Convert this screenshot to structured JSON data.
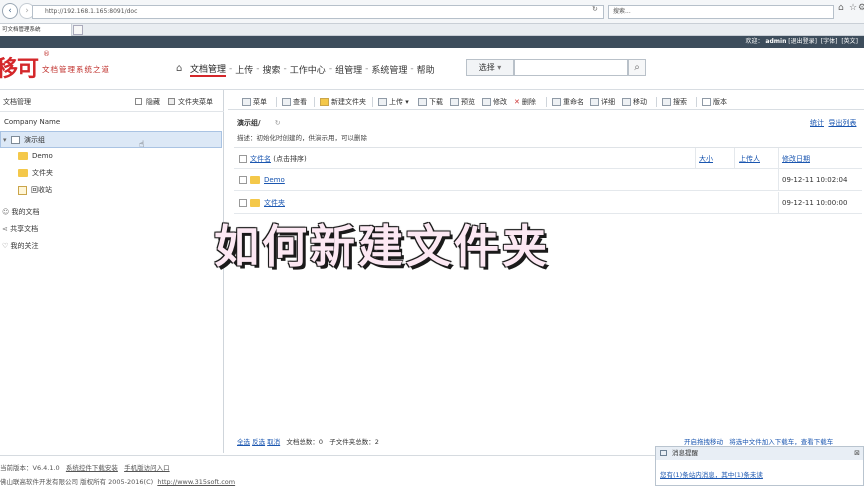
{
  "browser": {
    "address": "http://192.168.1.165:8091/doc",
    "search_placeholder": "搜索...",
    "tab_title": "可文档管理系统"
  },
  "top_strip": {
    "welcome": "欢迎：",
    "user": "admin",
    "logout": "[退出登录]",
    "font": "[字体]",
    "lang": "[英文]"
  },
  "logo": {
    "mark": "移可",
    "tagline": "文档管理系统之道",
    "reg": "®"
  },
  "main_nav": {
    "items": [
      "文档管理",
      "上传",
      "搜索",
      "工作中心",
      "组管理",
      "系统管理",
      "帮助"
    ]
  },
  "search": {
    "select_label": "选择",
    "dropdown_glyph": "▾",
    "button_glyph": "⌕"
  },
  "sidebar": {
    "title": "文档管理",
    "hide": "隐藏",
    "folder_menu": "文件夹菜单",
    "company": "Company Name",
    "group": "演示组",
    "folders": [
      "Demo",
      "文件夹",
      "回收站"
    ],
    "links": [
      "我的文档",
      "共享文档",
      "我的关注"
    ]
  },
  "toolbar": {
    "items": [
      "菜单",
      "查看",
      "新建文件夹",
      "上传",
      "下载",
      "预览",
      "修改",
      "删除",
      "重命名",
      "详细",
      "移动",
      "搜索",
      "版本"
    ]
  },
  "content": {
    "path": "演示组/",
    "desc": "描述：初始化时创建的，供演示用，可以删除",
    "stats_link": "统计",
    "export_link": "导出列表",
    "columns": {
      "name": "文件名",
      "sort_hint": "(点击排序)",
      "size": "大小",
      "uploader": "上传人",
      "modified": "修改日期"
    },
    "rows": [
      {
        "name": "Demo",
        "modified": "09-12-11 10:02:04"
      },
      {
        "name": "文件夹",
        "modified": "09-12-11 10:00:00"
      }
    ]
  },
  "footer": {
    "select_all": "全选",
    "invert": "反选",
    "cancel": "取消",
    "doc_count_label": "文档总数：",
    "doc_count": "0",
    "sub_count_label": "子文件夹总数：",
    "sub_count": "2",
    "drag_move": "开启拖拽移动",
    "drag_download": "将选中文件加入下载车，查看下载车"
  },
  "bottom": {
    "version": "当前版本：V6.4.1.0",
    "plugin": "系统控件下载安装",
    "mobile": "手机版访问入口",
    "copyright": "佛山联高软件开发有限公司 版权所有 2005-2016(C)",
    "site": "http://www.315soft.com"
  },
  "message": {
    "title": "消息提醒",
    "body": "您有(1)条站内消息，其中(1)条未读"
  },
  "overlay_text": "如何新建文件夹"
}
